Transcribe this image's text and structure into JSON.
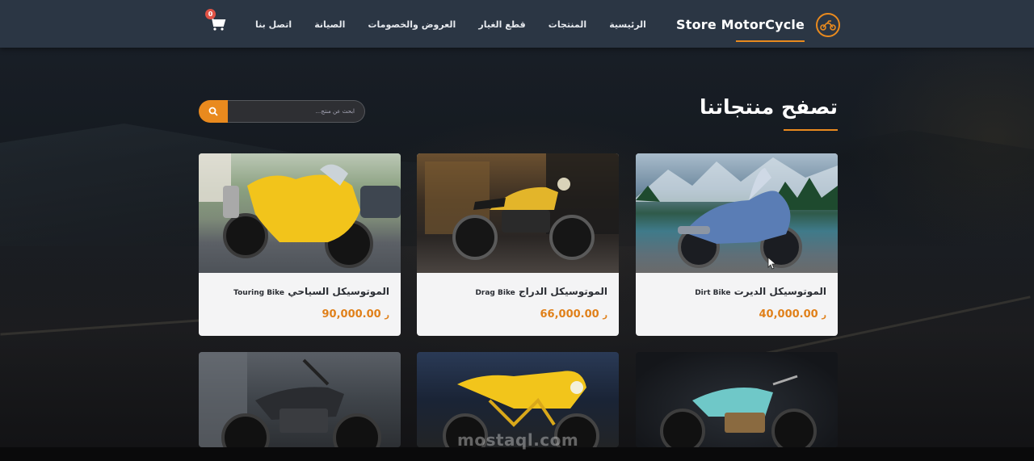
{
  "brand": {
    "name": "Store MotorCycle",
    "logo_icon": "motorcycle-icon",
    "accent": "#e98a1e"
  },
  "nav": {
    "items": [
      {
        "label": "الرئيسية"
      },
      {
        "label": "المنتجات"
      },
      {
        "label": "قطع الغيار"
      },
      {
        "label": "العروض والخصومات"
      },
      {
        "label": "الصيانة"
      },
      {
        "label": "اتصل بنا"
      }
    ],
    "cart": {
      "icon": "cart-icon",
      "count": "0"
    }
  },
  "section": {
    "title": "تصفح منتجاتنا"
  },
  "search": {
    "placeholder": "ابحث عن منتج...",
    "button_icon": "search-icon"
  },
  "products": [
    {
      "name_ar": "الموتوسيكل الديرت",
      "name_en": "Dirt Bike",
      "price": "40,000.00",
      "currency_icon": "riyal-icon"
    },
    {
      "name_ar": "الموتوسيكل الدراج",
      "name_en": "Drag Bike",
      "price": "66,000.00",
      "currency_icon": "riyal-icon"
    },
    {
      "name_ar": "الموتوسيكل السياحي",
      "name_en": "Touring Bike",
      "price": "90,000.00",
      "currency_icon": "riyal-icon"
    }
  ],
  "watermark": "mostaql.com",
  "colors": {
    "navbar": "#2b3644",
    "accent": "#e98a1e",
    "card": "#f4f4f5",
    "price": "#e0801a",
    "badge": "#e05245"
  }
}
